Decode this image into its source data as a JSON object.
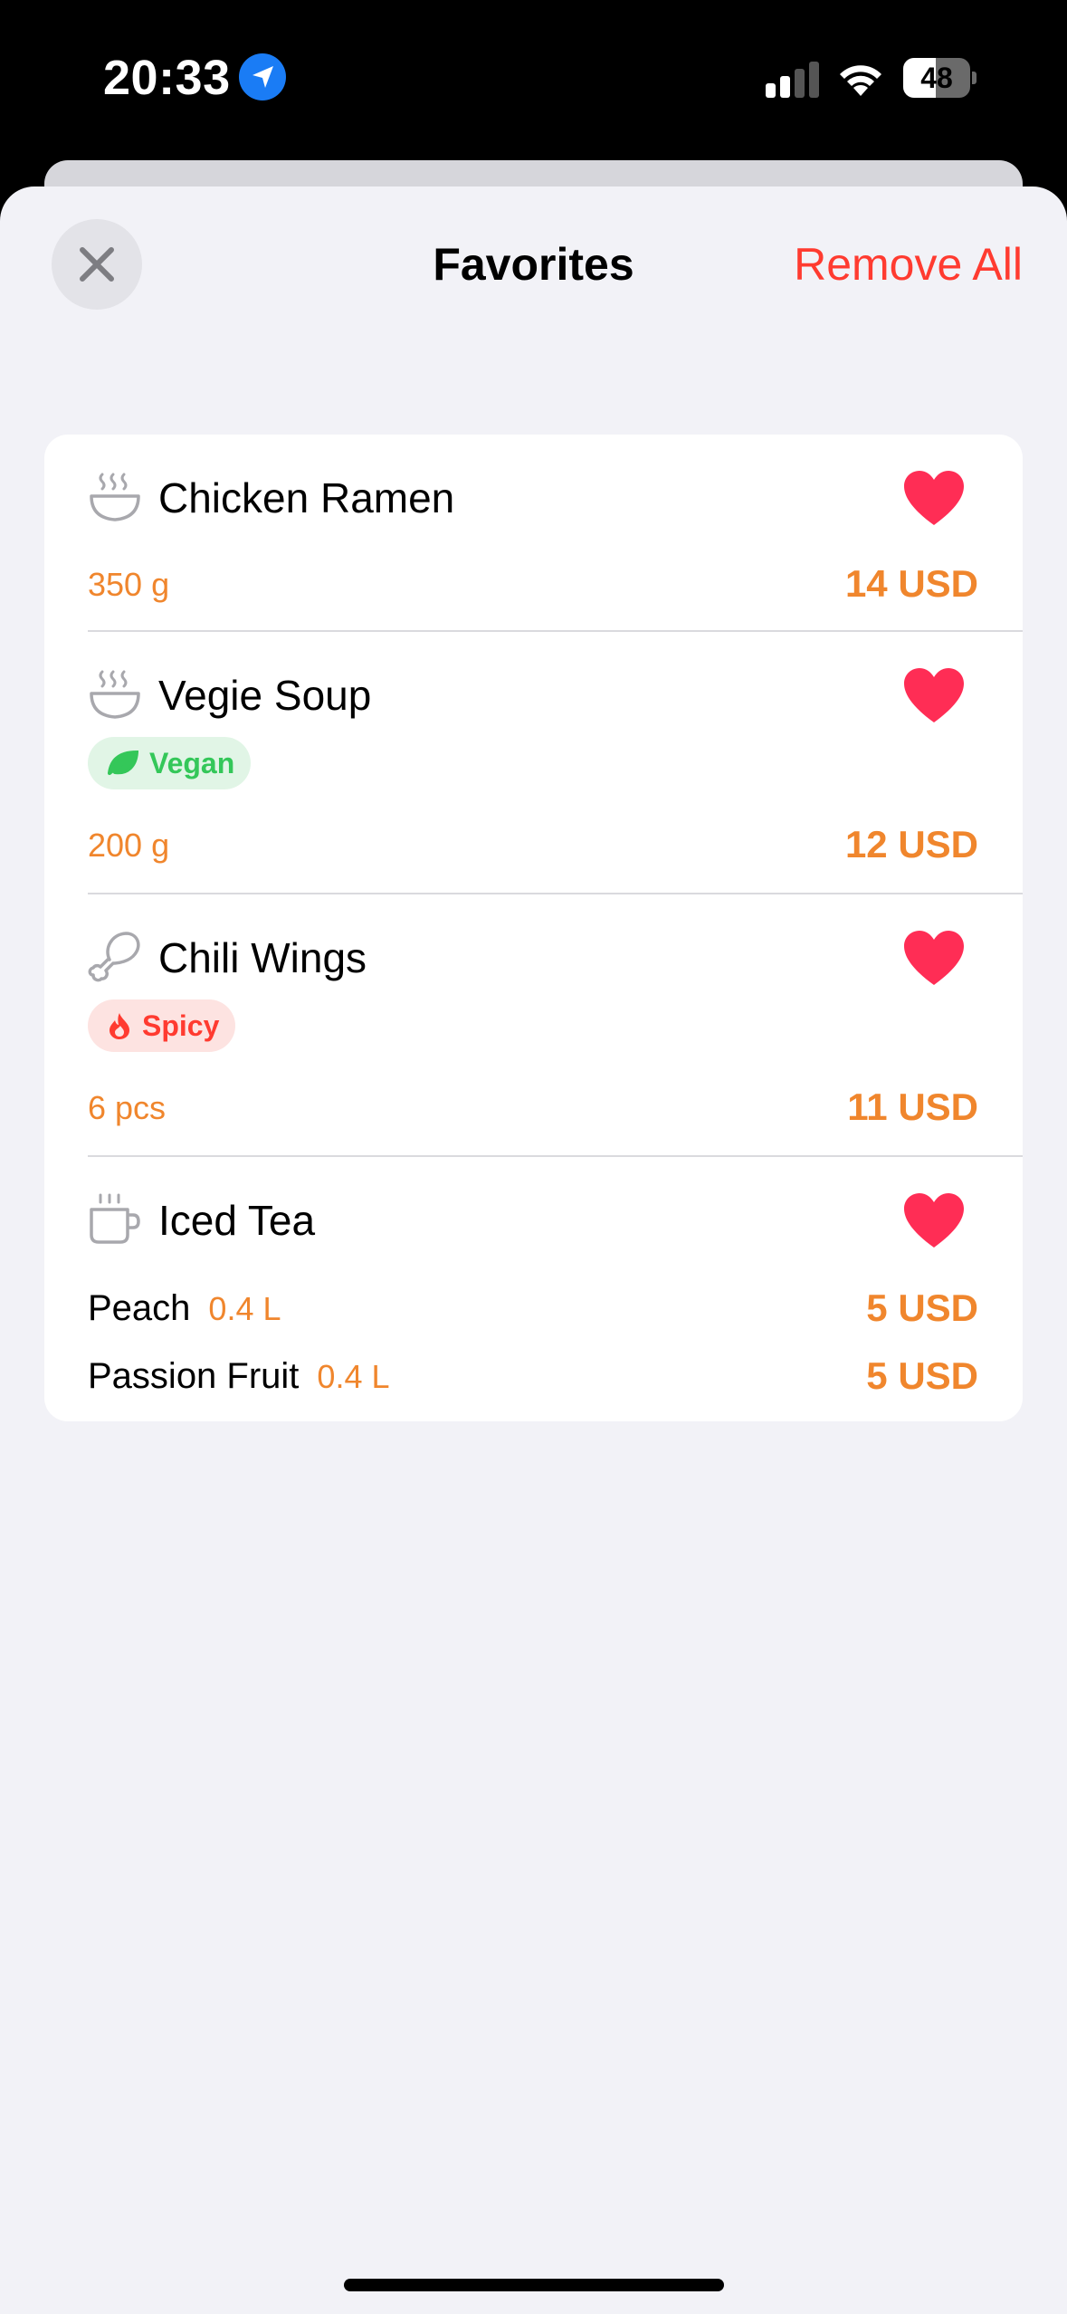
{
  "status_bar": {
    "time": "20:33",
    "battery_level": "48",
    "battery_fraction": 0.48,
    "icons": [
      "location-arrow-icon",
      "cellular-signal-icon",
      "wifi-icon",
      "battery-icon"
    ]
  },
  "sheet": {
    "title": "Favorites",
    "remove_all_label": "Remove All",
    "close_icon": "close-icon"
  },
  "items": [
    {
      "name": "Chicken Ramen",
      "icon": "bowl-icon",
      "quantity": "350 g",
      "price": "14 USD",
      "favorite": true
    },
    {
      "name": "Vegie Soup",
      "icon": "bowl-icon",
      "tag": "Vegan",
      "tag_icon": "leaf-icon",
      "quantity": "200 g",
      "price": "12 USD",
      "favorite": true
    },
    {
      "name": "Chili Wings",
      "icon": "drumstick-icon",
      "tag": "Spicy",
      "tag_icon": "flame-icon",
      "quantity": "6 pcs",
      "price": "11 USD",
      "favorite": true
    },
    {
      "name": "Iced Tea",
      "icon": "cup-icon",
      "favorite": true,
      "variants": [
        {
          "name": "Peach",
          "size": "0.4 L",
          "price": "5 USD"
        },
        {
          "name": "Passion Fruit",
          "size": "0.4 L",
          "price": "5 USD"
        }
      ]
    }
  ],
  "colors": {
    "accent_orange": "#f0862d",
    "destructive_red": "#ff3b30",
    "heart": "#ff2d55",
    "vegan_green": "#34c759",
    "background": "#f2f2f7"
  }
}
